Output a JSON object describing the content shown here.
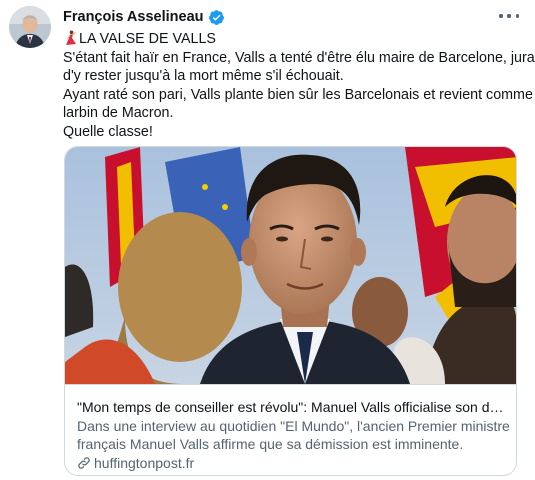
{
  "author": {
    "name": "François Asselineau",
    "verified": true
  },
  "tweet": {
    "lines": [
      "LA VALSE DE VALLS",
      "S'étant fait haïr en France, Valls a tenté d'être élu maire de Barcelone, jurant",
      "d'y rester jusqu'à la mort même s'il échouait.",
      "Ayant raté son pari, Valls plante bien sûr les Barcelonais et revient comme",
      "larbin de Macron.",
      "Quelle classe!"
    ],
    "leading_emoji": "dancer-icon"
  },
  "card": {
    "title": "\"Mon temps de conseiller est révolu\": Manuel Valls officialise son départ...",
    "description_lines": [
      "Dans une interview au quotidien \"El Mundo\", l'ancien Premier ministre",
      "français Manuel Valls affirme que sa démission est imminente."
    ],
    "domain": "huffingtonpost.fr"
  },
  "colors": {
    "text": "#0f1419",
    "secondary": "#536471",
    "border": "#cfd9de",
    "verified": "#1d9bf0",
    "flag_red": "#c8102e",
    "flag_yellow": "#f1bf00",
    "eu_blue": "#3a63b8"
  }
}
